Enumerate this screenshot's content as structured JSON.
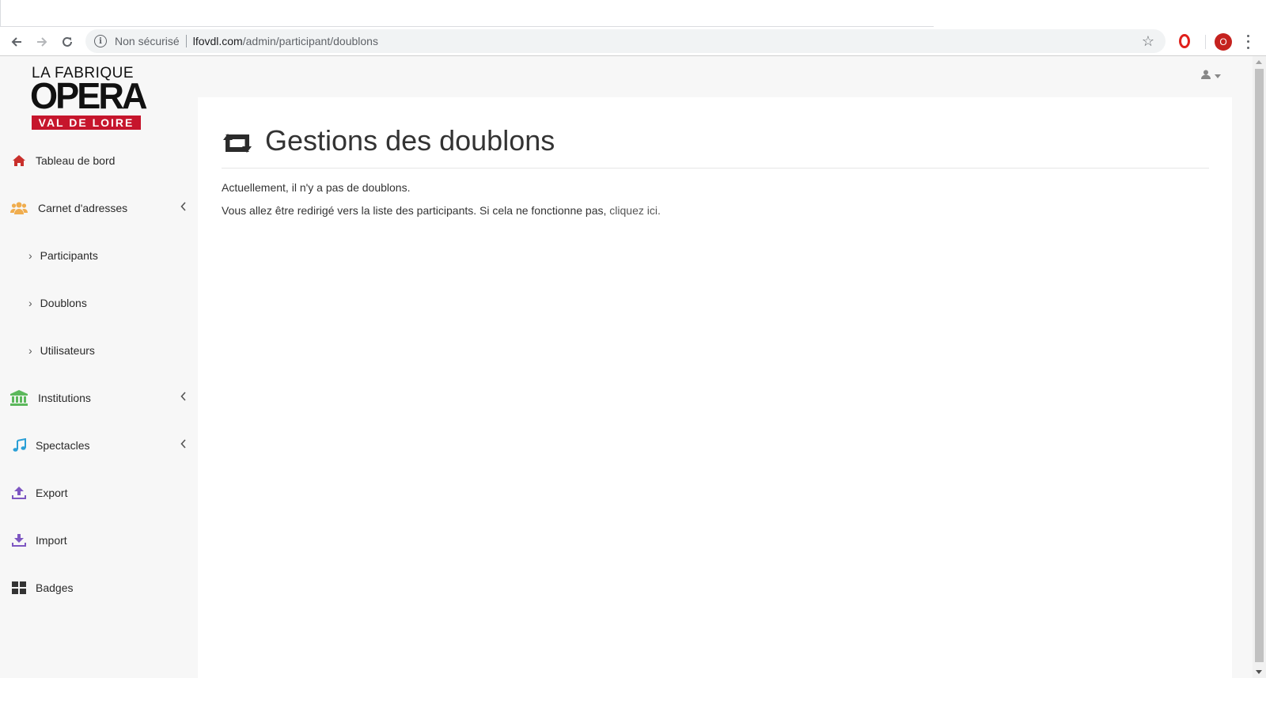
{
  "browser": {
    "security_label": "Non sécurisé",
    "url_host": "lfovdl.com",
    "url_path": "/admin/participant/doublons",
    "profile_initial": "O"
  },
  "logo": {
    "line1": "LA FABRIQUE",
    "line2": "OPERA",
    "line3": "VAL DE LOIRE",
    "accent_color": "#c6152c"
  },
  "sidebar": {
    "items": [
      {
        "label": "Tableau de bord",
        "icon": "home-icon",
        "color": "#c9302c"
      },
      {
        "label": "Carnet d'adresses",
        "icon": "users-icon",
        "color": "#f0ad4e"
      },
      {
        "label": "Participants",
        "icon": "chevron-right-icon"
      },
      {
        "label": "Doublons",
        "icon": "chevron-right-icon"
      },
      {
        "label": "Utilisateurs",
        "icon": "chevron-right-icon"
      },
      {
        "label": "Institutions",
        "icon": "bank-icon",
        "color": "#5cb85c"
      },
      {
        "label": "Spectacles",
        "icon": "music-icon",
        "color": "#2a9fd6"
      },
      {
        "label": "Export",
        "icon": "upload-icon",
        "color": "#7e57c2"
      },
      {
        "label": "Import",
        "icon": "download-icon",
        "color": "#7e57c2"
      },
      {
        "label": "Badges",
        "icon": "grid-icon",
        "color": "#333333"
      }
    ]
  },
  "main": {
    "title": "Gestions des doublons",
    "message1": "Actuellement, il n'y a pas de doublons.",
    "message2": "Vous allez être redirigé vers la liste des participants. Si cela ne fonctionne pas,",
    "link_text": "cliquez ici."
  }
}
